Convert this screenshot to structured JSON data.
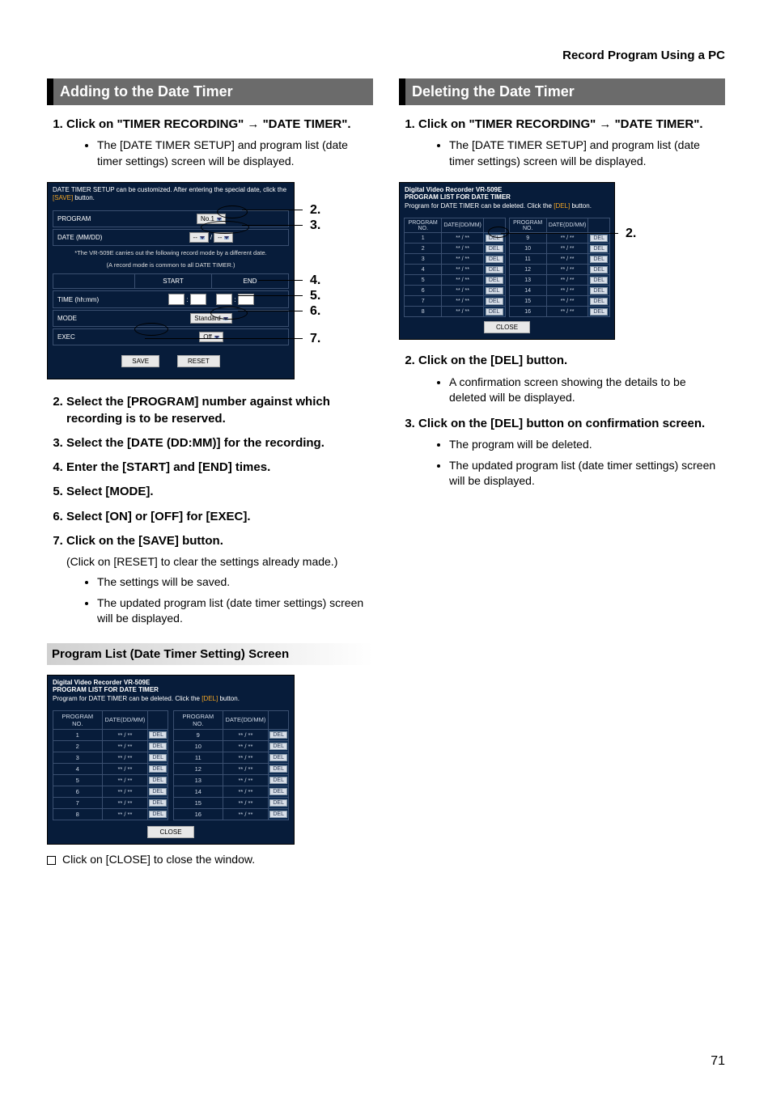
{
  "breadcrumb": "Record Program Using a PC",
  "left": {
    "heading": "Adding to the Date Timer",
    "step1": "Click on \"TIMER RECORDING\" → \"DATE TIMER\".",
    "step1_b1": "The [DATE TIMER SETUP] and program list (date timer settings) screen will be displayed.",
    "step2": "Select the [PROGRAM] number against which recording is to be reserved.",
    "step3": "Select the [DATE (DD:MM)] for the recording.",
    "step4": "Enter the [START] and [END] times.",
    "step5": "Select [MODE].",
    "step6": "Select [ON] or [OFF] for [EXEC].",
    "step7": "Click on the [SAVE] button.",
    "step7_p": "(Click on [RESET] to clear the settings already made.)",
    "step7_b1": "The settings will be saved.",
    "step7_b2": "The updated program list (date timer settings) screen will be displayed.",
    "subheading": "Program List (Date Timer Setting) Screen",
    "close_note": "Click on [CLOSE] to close the window.",
    "setup": {
      "note_a": "DATE TIMER SETUP can be customized. After entering the special date, click the ",
      "note_save": "[SAVE]",
      "note_b": " button.",
      "row_program": "PROGRAM",
      "program_val": "No.1",
      "row_date": "DATE (MM/DD)",
      "dash": "--",
      "minor1": "*The VR-509E carries out the following record mode by a different date.",
      "minor2": "(A record mode is common to all DATE TIMER.)",
      "start": "START",
      "end": "END",
      "row_time": "TIME (hh:mm)",
      "row_mode": "MODE",
      "mode_val": "Standard",
      "row_exec": "EXEC",
      "exec_val": "Off",
      "btn_save": "SAVE",
      "btn_reset": "RESET"
    },
    "list": {
      "ttl1": "Digital Video Recorder VR-509E",
      "ttl2": "PROGRAM LIST FOR DATE TIMER",
      "hint_a": "Program for DATE TIMER can be deleted. Click the ",
      "hint_del": "[DEL]",
      "hint_b": " button.",
      "col_no": "PROGRAM NO.",
      "col_date": "DATE(DD/MM)",
      "cell_placeholder": "** / **",
      "del": "DEL",
      "close": "CLOSE",
      "left_nos": [
        "1",
        "2",
        "3",
        "4",
        "5",
        "6",
        "7",
        "8"
      ],
      "right_nos": [
        "9",
        "10",
        "11",
        "12",
        "13",
        "14",
        "15",
        "16"
      ]
    },
    "callouts": {
      "c2": "2.",
      "c3": "3.",
      "c4": "4.",
      "c5": "5.",
      "c6": "6.",
      "c7": "7."
    }
  },
  "right": {
    "heading": "Deleting the Date Timer",
    "step1": "Click on \"TIMER RECORDING\" → \"DATE TIMER\".",
    "step1_b1": "The [DATE TIMER SETUP] and program list (date timer settings) screen will be displayed.",
    "step2": "Click on the [DEL] button.",
    "step2_b1": "A confirmation screen showing the details to be deleted will be displayed.",
    "step3": "Click on the [DEL] button on confirmation screen.",
    "step3_b1": "The program will be deleted.",
    "step3_b2": "The updated program list (date timer settings) screen will be displayed.",
    "callout2": "2."
  },
  "page_number": "71"
}
